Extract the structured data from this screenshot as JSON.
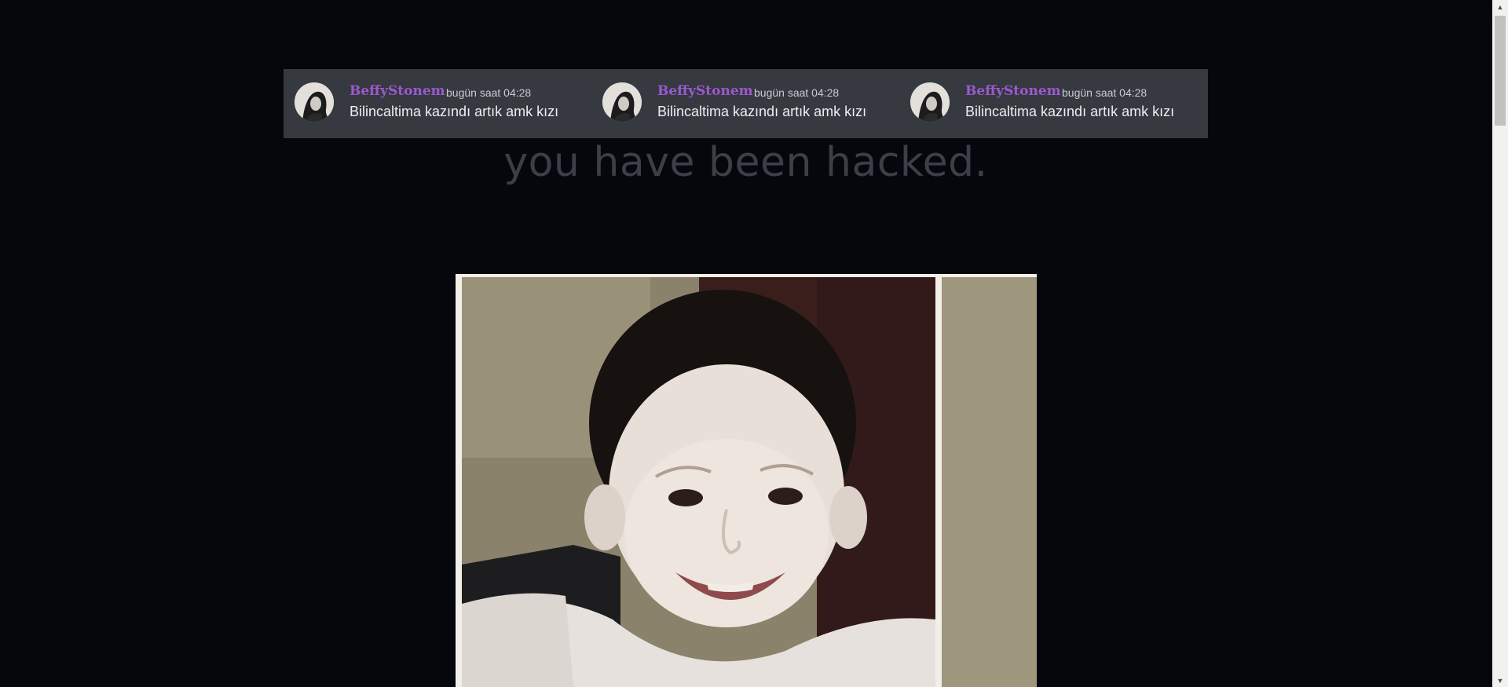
{
  "banner": {
    "messages": [
      {
        "username": "BeffyStonem",
        "timestamp": "bugün saat 04:28",
        "text": "Bilincaltima kazındı artık amk kızı"
      },
      {
        "username": "BeffyStonem",
        "timestamp": "bugün saat 04:28",
        "text": "Bilincaltima kazındı artık amk kızı"
      },
      {
        "username": "BeffyStonem",
        "timestamp": "bugün saat 04:28",
        "text": "Bilincaltima kazındı artık amk kızı"
      }
    ]
  },
  "headline": "you have been hacked.",
  "colors": {
    "background": "#06060d",
    "banner_bg": "#36393f",
    "username": "#9b59d0",
    "headline": "#3b3f47"
  },
  "icons": {
    "scroll_up": "triangle-up-icon",
    "scroll_down": "triangle-down-icon"
  }
}
